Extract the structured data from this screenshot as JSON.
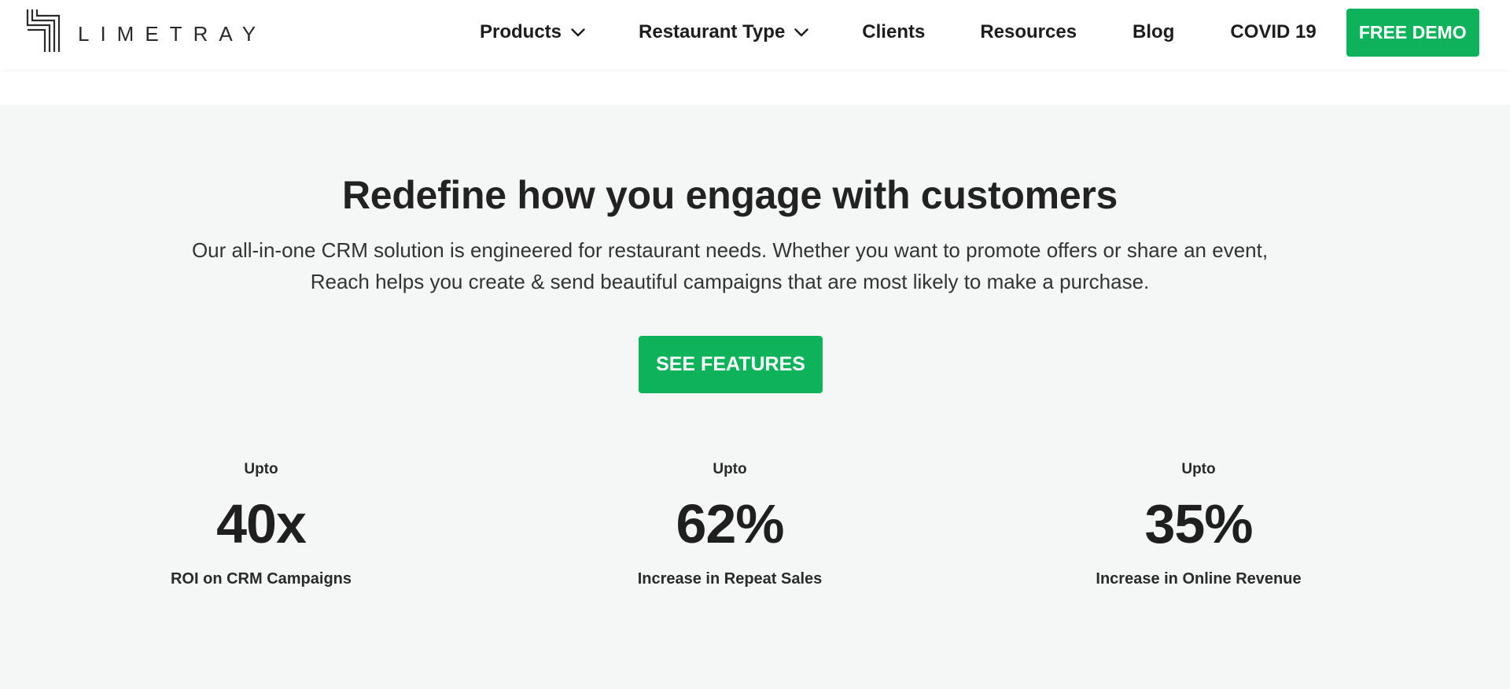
{
  "header": {
    "logo_text": "LIMETRAY",
    "nav": {
      "products": "Products",
      "restaurant_type": "Restaurant Type",
      "clients": "Clients",
      "resources": "Resources",
      "blog": "Blog",
      "covid": "COVID 19"
    },
    "cta_label": "FREE DEMO"
  },
  "hero": {
    "title": "Redefine how you engage with customers",
    "description_line1": "Our all-in-one CRM solution is engineered for restaurant needs. Whether you want to promote offers or share an event,",
    "description_line2": "Reach helps you create & send beautiful campaigns that are most likely to make a purchase.",
    "cta_label": "SEE FEATURES"
  },
  "stats": [
    {
      "prefix": "Upto",
      "value": "40x",
      "label": "ROI on CRM Campaigns"
    },
    {
      "prefix": "Upto",
      "value": "62%",
      "label": "Increase in Repeat Sales"
    },
    {
      "prefix": "Upto",
      "value": "35%",
      "label": "Increase in Online Revenue"
    }
  ],
  "colors": {
    "accent": "#0db25a",
    "hero_background": "#f5f7f6",
    "text": "#222222"
  },
  "icons": {
    "logo": "limetray-logo-mark",
    "dropdown": "chevron-down-icon"
  }
}
